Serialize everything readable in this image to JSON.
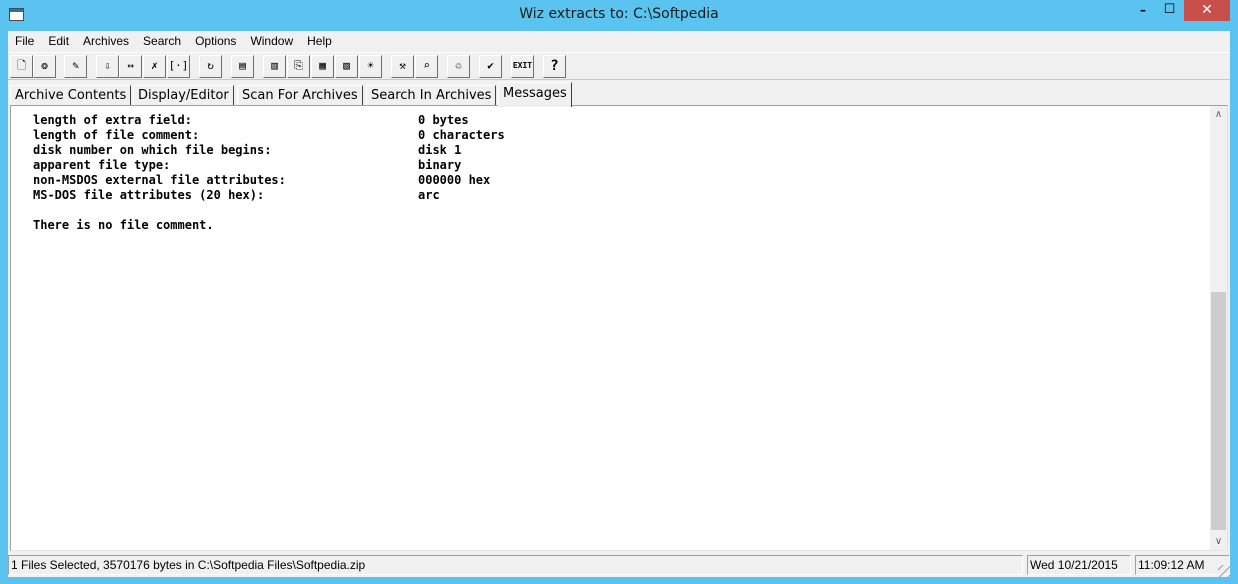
{
  "window": {
    "title": "Wiz extracts to: C:\\Softpedia",
    "controls": {
      "minimize": "–",
      "maximize": "☐",
      "close": "✕"
    }
  },
  "menu": [
    "File",
    "Edit",
    "Archives",
    "Search",
    "Options",
    "Window",
    "Help"
  ],
  "toolbar": {
    "buttons": [
      {
        "name": "new-icon",
        "glyph": "🗋"
      },
      {
        "name": "open-archive-icon",
        "glyph": "❂"
      },
      {
        "name": "edit-icon",
        "glyph": "✎"
      },
      {
        "name": "extract-icon",
        "glyph": "⇩"
      },
      {
        "name": "move-icon",
        "glyph": "↔"
      },
      {
        "name": "delete-mark-icon",
        "glyph": "✗"
      },
      {
        "name": "brackets-icon",
        "glyph": "[·]"
      },
      {
        "name": "refresh-icon",
        "glyph": "↻"
      },
      {
        "name": "document-icon",
        "glyph": "▤"
      },
      {
        "name": "bookmark-icon",
        "glyph": "▥"
      },
      {
        "name": "save-icon",
        "glyph": "⎘"
      },
      {
        "name": "film-icon",
        "glyph": "▦"
      },
      {
        "name": "page-icon",
        "glyph": "▧"
      },
      {
        "name": "bulb-icon",
        "glyph": "☀"
      },
      {
        "name": "tools-icon",
        "glyph": "⚒"
      },
      {
        "name": "search-icon",
        "glyph": "⌕"
      },
      {
        "name": "trash-icon",
        "glyph": "♲"
      },
      {
        "name": "check-icon",
        "glyph": "✔"
      },
      {
        "name": "exit-icon",
        "glyph": "EXIT"
      },
      {
        "name": "help-icon",
        "glyph": "?"
      }
    ]
  },
  "tabs": [
    {
      "label": "Archive Contents",
      "active": false
    },
    {
      "label": "Display/Editor",
      "active": false
    },
    {
      "label": "Scan For Archives",
      "active": false
    },
    {
      "label": "Search In Archives",
      "active": false
    },
    {
      "label": "Messages",
      "active": true
    }
  ],
  "messages": [
    {
      "label": "length of extra field:",
      "value": "0 bytes"
    },
    {
      "label": "length of file comment:",
      "value": "0 characters"
    },
    {
      "label": "disk number on which file begins:",
      "value": "disk 1"
    },
    {
      "label": "apparent file type:",
      "value": "binary"
    },
    {
      "label": "non-MSDOS external file attributes:",
      "value": "000000 hex"
    },
    {
      "label": "MS-DOS file attributes (20 hex):",
      "value": "arc"
    },
    {
      "label": "",
      "value": ""
    },
    {
      "label": "There is no file comment.",
      "value": ""
    }
  ],
  "scrollbar": {
    "up": "∧",
    "down": "∨",
    "position_fraction": 0.55
  },
  "status": {
    "selection": "1 Files Selected, 3570176 bytes in C:\\Softpedia Files\\Softpedia.zip",
    "date": "Wed 10/21/2015",
    "time": "11:09:12 AM"
  }
}
